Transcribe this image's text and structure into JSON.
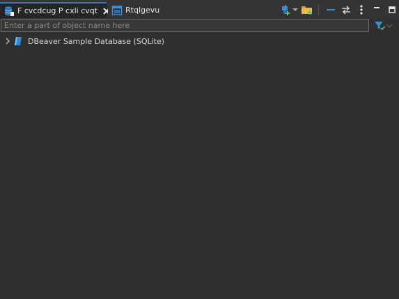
{
  "tabs": [
    {
      "label": "F cvcdcug P cxli cvqt",
      "active": true,
      "icon": "database-navigator-icon"
    },
    {
      "label": "Rtqlgevu",
      "active": false,
      "icon": "projects-icon"
    }
  ],
  "toolbar": {
    "icons": [
      "new-connection-icon",
      "dropdown-arrow-icon",
      "new-folder-icon",
      "collapse-all-icon",
      "link-with-editor-icon",
      "view-menu-icon",
      "minimize-icon",
      "maximize-icon"
    ]
  },
  "filter": {
    "placeholder": "Enter a part of object name here",
    "value": ""
  },
  "tree": {
    "items": [
      {
        "label": "DBeaver Sample Database (SQLite)",
        "icon": "sqlite-database-icon",
        "expanded": false
      }
    ]
  },
  "colors": {
    "background": "#2f2f2f",
    "tab_active": "#252526",
    "accent": "#2b7bd6"
  }
}
